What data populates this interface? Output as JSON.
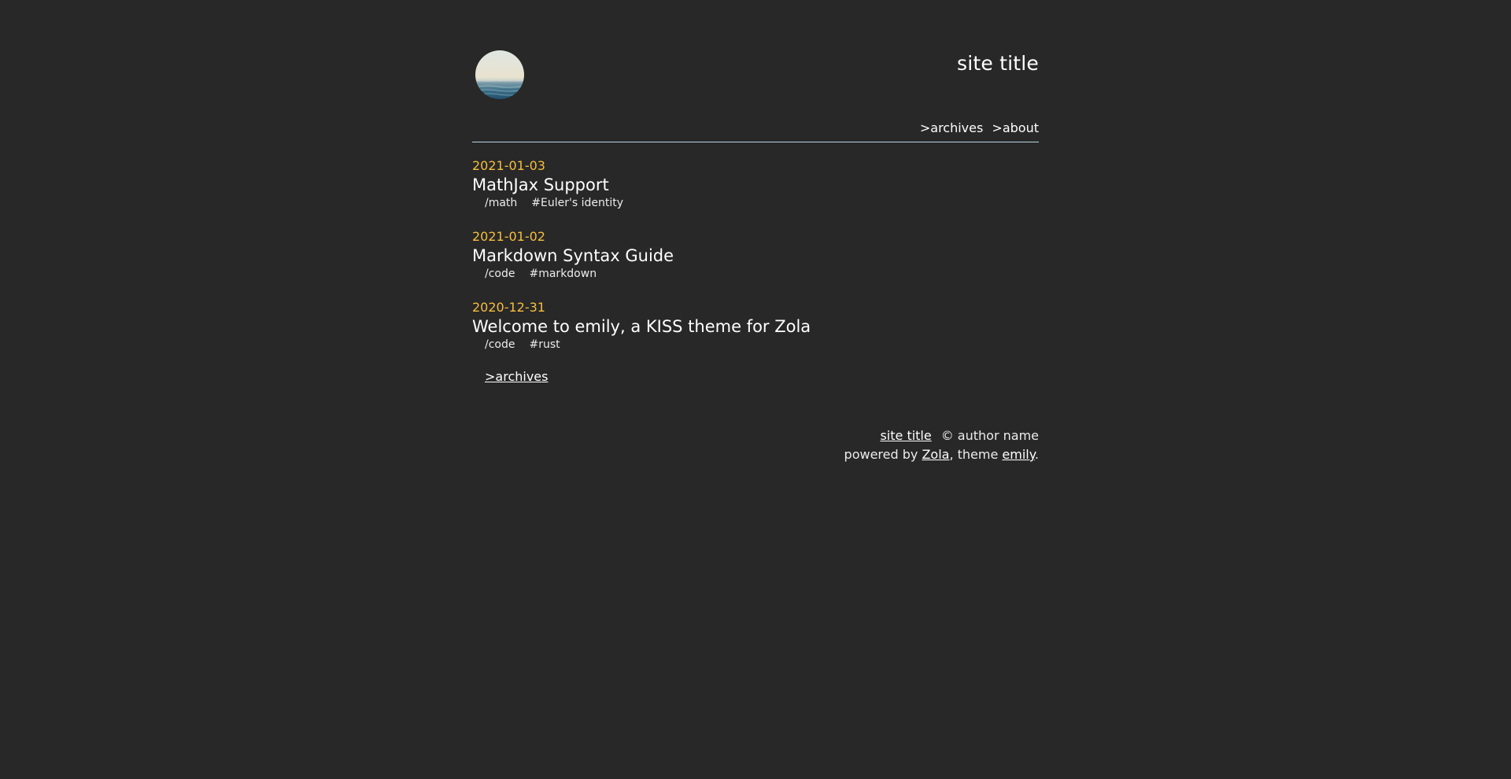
{
  "header": {
    "site_title": "site title",
    "avatar_alt": "avatar",
    "nav": [
      {
        "label": ">archives"
      },
      {
        "label": ">about"
      }
    ]
  },
  "posts": [
    {
      "date": "2021-01-03",
      "title": "MathJax Support",
      "category": "/math",
      "tag": "#Euler's identity"
    },
    {
      "date": "2021-01-02",
      "title": "Markdown Syntax Guide",
      "category": "/code",
      "tag": "#markdown"
    },
    {
      "date": "2020-12-31",
      "title": "Welcome to emily, a KISS theme for Zola",
      "category": "/code",
      "tag": "#rust"
    }
  ],
  "archives_link": ">archives",
  "footer": {
    "site_title_link": "site title",
    "copyright": "© author name",
    "powered_prefix": "powered by ",
    "zola_link": "Zola",
    "theme_text": ", theme ",
    "emily_link": "emily",
    "period": "."
  },
  "colors": {
    "background": "#282828",
    "date_accent": "#f6be3e",
    "header_rule": "#b5d7e4",
    "text": "#f2f2f2"
  }
}
